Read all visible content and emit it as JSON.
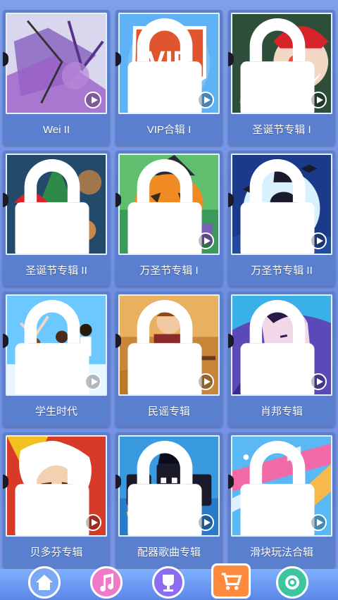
{
  "albums": [
    {
      "title": "Wei II",
      "locked": false,
      "art": "abstract-purple"
    },
    {
      "title": "VIP合辑 I",
      "locked": true,
      "art": "vip-badge"
    },
    {
      "title": "圣诞节专辑 I",
      "locked": true,
      "art": "santa"
    },
    {
      "title": "圣诞节专辑 II",
      "locked": true,
      "art": "christmas-tree"
    },
    {
      "title": "万圣节专辑 I",
      "locked": true,
      "art": "pumpkin"
    },
    {
      "title": "万圣节专辑 II",
      "locked": true,
      "art": "moon-night"
    },
    {
      "title": "学生时代",
      "locked": true,
      "art": "students-jumping"
    },
    {
      "title": "民谣专辑",
      "locked": true,
      "art": "guitar-player"
    },
    {
      "title": "肖邦专辑",
      "locked": true,
      "art": "chopin-portrait"
    },
    {
      "title": "贝多芬专辑",
      "locked": true,
      "art": "beethoven-portrait"
    },
    {
      "title": "配器歌曲专辑",
      "locked": true,
      "art": "orchestra"
    },
    {
      "title": "滑块玩法合辑",
      "locked": true,
      "art": "slider-tiles"
    }
  ],
  "vip_text": "VIP",
  "bottom_nav": [
    {
      "icon": "home-icon",
      "color": "#7aa8f5"
    },
    {
      "icon": "music-note-icon",
      "color": "#f07ac8"
    },
    {
      "icon": "trophy-icon",
      "color": "#8a6df0"
    },
    {
      "icon": "shop-cart-icon",
      "color": "#ff8a3d"
    },
    {
      "icon": "settings-gear-icon",
      "color": "#3cc6a0"
    }
  ]
}
